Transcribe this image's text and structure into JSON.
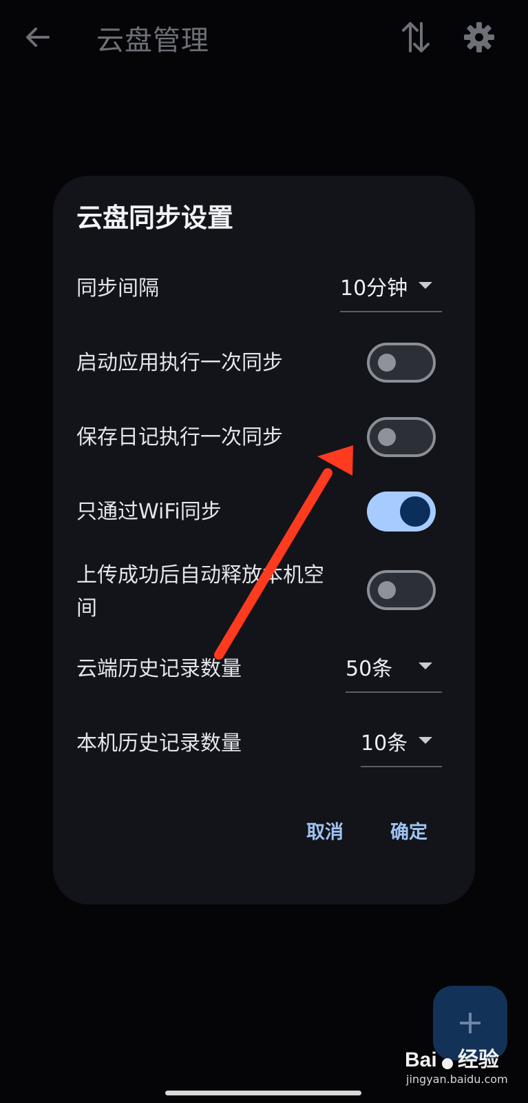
{
  "app_bar": {
    "title": "云盘管理",
    "icons": [
      "arrow-back-icon",
      "sort-icon",
      "gear-icon"
    ]
  },
  "dialog": {
    "title": "云盘同步设置",
    "sync_interval": {
      "label": "同步间隔",
      "value": "10分钟"
    },
    "toggles": [
      {
        "label": "启动应用执行一次同步",
        "on": false
      },
      {
        "label": "保存日记执行一次同步",
        "on": false
      },
      {
        "label": "只通过WiFi同步",
        "on": true
      },
      {
        "label": "上传成功后自动释放本机空间",
        "on": false
      }
    ],
    "cloud_history": {
      "label": "云端历史记录数量",
      "value": "50条"
    },
    "local_history": {
      "label": "本机历史记录数量",
      "value": "10条"
    },
    "cancel_label": "取消",
    "confirm_label": "确定"
  },
  "fab": {
    "icon": "plus-icon"
  },
  "watermark": {
    "brand": "Bai",
    "brand_suffix": "经验",
    "domain": "jingyan.baidu.com"
  },
  "colors": {
    "background": "#050507",
    "dialog": "#121419",
    "accent": "#a6ccff",
    "annotation_arrow": "#ff3b1f"
  }
}
